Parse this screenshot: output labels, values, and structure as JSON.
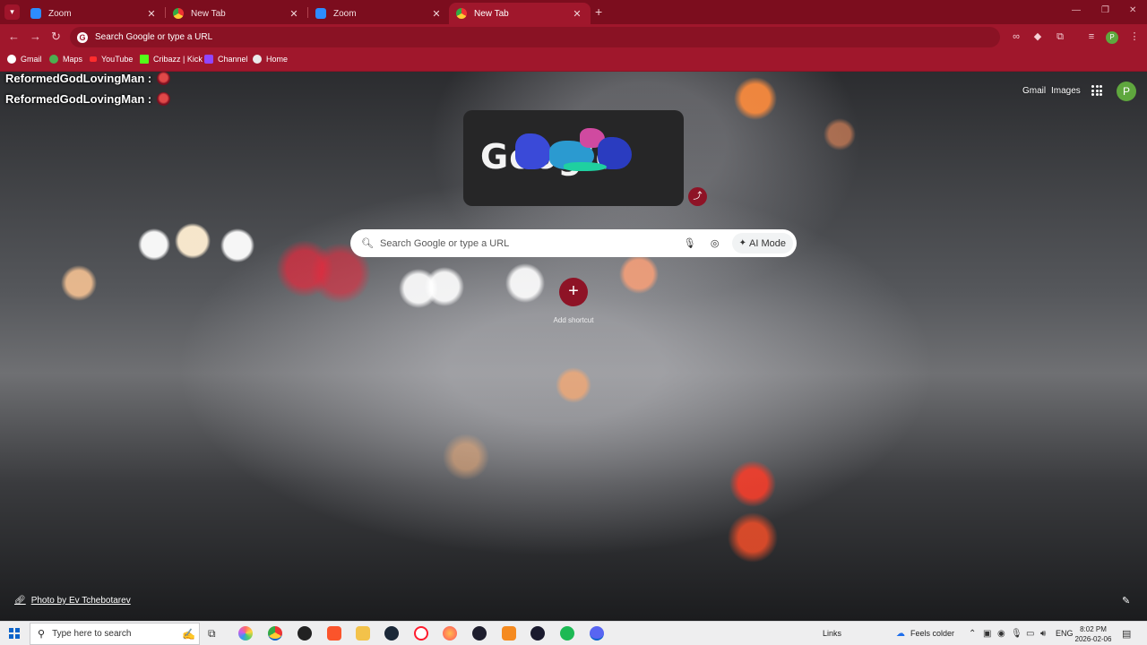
{
  "tabs": [
    {
      "title": "Zoom",
      "favicon": "zoom-icon",
      "active": false
    },
    {
      "title": "New Tab",
      "favicon": "chrome-icon",
      "active": false
    },
    {
      "title": "Zoom",
      "favicon": "zoom-icon",
      "active": false
    },
    {
      "title": "New Tab",
      "favicon": "chrome-icon",
      "active": true
    }
  ],
  "omnibox": {
    "placeholder": "Search Google or type a URL"
  },
  "bookmarks": [
    {
      "label": "Gmail",
      "icon": "google-icon"
    },
    {
      "label": "Maps",
      "icon": "maps-icon"
    },
    {
      "label": "YouTube",
      "icon": "youtube-icon"
    },
    {
      "label": "Cribazz | Kick",
      "icon": "kick-icon"
    },
    {
      "label": "Channel",
      "icon": "twitch-icon"
    },
    {
      "label": "Home",
      "icon": "chrome-icon"
    }
  ],
  "overlay": {
    "user1": "ReformedGodLovingMan :",
    "user2": "ReformedGodLovingMan :"
  },
  "ntp": {
    "gmail": "Gmail",
    "images": "Images",
    "profile_initial": "P",
    "doodle_text": "Google",
    "search_placeholder": "Search Google or type a URL",
    "ai_mode": "AI Mode",
    "add_shortcut": "Add shortcut",
    "photo_credit": "Photo by Ev Tchebotarev"
  },
  "taskbar": {
    "search_placeholder": "Type here to search",
    "links": "Links",
    "weather": "Feels colder",
    "lang": "ENG",
    "time": "8:02 PM",
    "date": "2026-02-06"
  },
  "colors": {
    "tabstrip": "#7c0d1e",
    "toolbar": "#a0172c",
    "accent": "#8e1326",
    "profile": "#5fa73e"
  }
}
